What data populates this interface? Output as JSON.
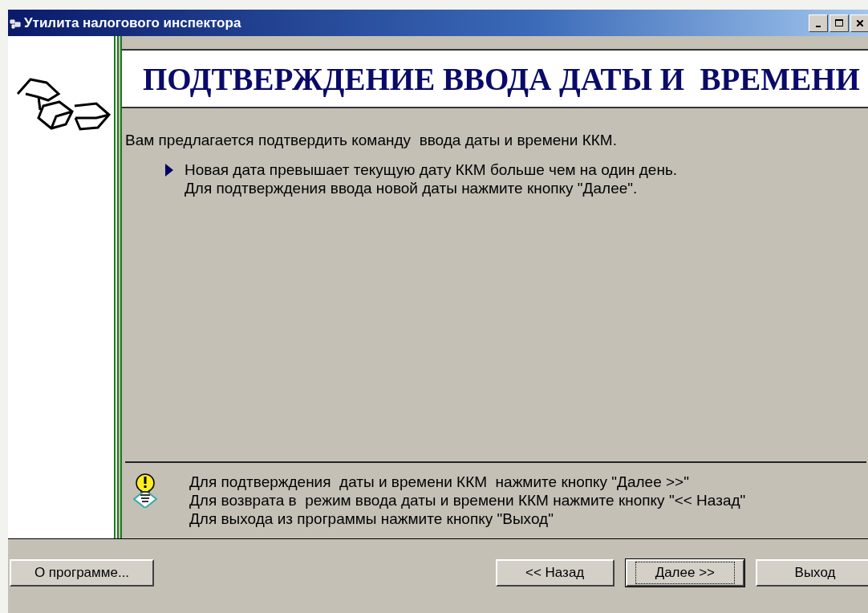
{
  "window": {
    "title": "Утилита налогового инспектора"
  },
  "header": {
    "title": "ПОДТВЕРЖДЕНИЕ ВВОДА ДАТЫ И  ВРЕМЕНИ"
  },
  "intro": "Вам предлагается подтвердить команду  ввода даты и времени ККМ.",
  "notice": [
    "Новая дата превышает текущую дату ККМ больше чем на один день.",
    "Для подтверждения ввода новой даты нажмите кнопку \"Далее\"."
  ],
  "hints": [
    "Для подтверждения  даты и времени ККМ  нажмите кнопку \"Далее >>\"",
    "Для возврата в  режим ввода даты и времени ККМ нажмите кнопку \"<< Назад\"",
    "Для выхода из программы нажмите кнопку \"Выход\""
  ],
  "about_button": {
    "label": "О программе..."
  },
  "buttons": [
    {
      "label": "<< Назад",
      "default": false
    },
    {
      "label": "Далее >>",
      "default": true
    },
    {
      "label": "Выход",
      "default": false
    }
  ]
}
